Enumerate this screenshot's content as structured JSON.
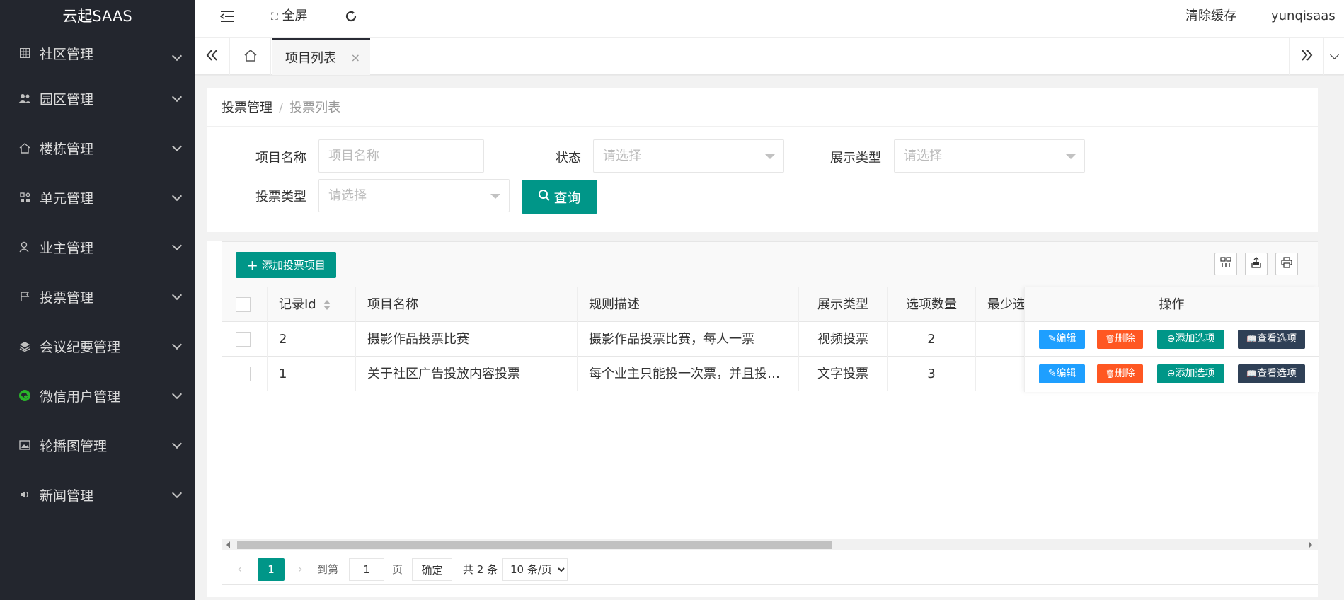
{
  "app": {
    "logo": "云起SAAS"
  },
  "sidebar": {
    "items": [
      {
        "label": "社区管理",
        "icon": "grid-icon"
      },
      {
        "label": "园区管理",
        "icon": "users-icon"
      },
      {
        "label": "楼栋管理",
        "icon": "home-icon"
      },
      {
        "label": "单元管理",
        "icon": "apps-icon"
      },
      {
        "label": "业主管理",
        "icon": "user-icon"
      },
      {
        "label": "投票管理",
        "icon": "flag-icon"
      },
      {
        "label": "会议纪要管理",
        "icon": "layers-icon"
      },
      {
        "label": "微信用户管理",
        "icon": "wechat-icon"
      },
      {
        "label": "轮播图管理",
        "icon": "image-icon"
      },
      {
        "label": "新闻管理",
        "icon": "speaker-icon"
      }
    ]
  },
  "header": {
    "fullscreen_label": "全屏",
    "clear_cache_label": "清除缓存",
    "username": "yunqisaas"
  },
  "tabs": {
    "active_label": "项目列表",
    "close_glyph": "×"
  },
  "breadcrumb": {
    "parent": "投票管理",
    "separator": "/",
    "current": "投票列表"
  },
  "filters": {
    "project_name_label": "项目名称",
    "project_name_placeholder": "项目名称",
    "status_label": "状态",
    "status_placeholder": "请选择",
    "display_type_label": "展示类型",
    "display_type_placeholder": "请选择",
    "vote_type_label": "投票类型",
    "vote_type_placeholder": "请选择",
    "query_label": "查询"
  },
  "toolbar": {
    "add_label": "添加投票项目"
  },
  "table": {
    "headers": {
      "record_id": "记录Id",
      "project_name": "项目名称",
      "rule_desc": "规则描述",
      "display_type": "展示类型",
      "option_count": "选项数量",
      "min": "最少选",
      "ops": "操作"
    },
    "rows": [
      {
        "record_id": "2",
        "project_name": "摄影作品投票比赛",
        "rule_desc": "摄影作品投票比赛，每人一票",
        "display_type": "视频投票",
        "option_count": "2"
      },
      {
        "record_id": "1",
        "project_name": "关于社区广告投放内容投票",
        "rule_desc": "每个业主只能投一次票，并且投…",
        "display_type": "文字投票",
        "option_count": "3"
      }
    ],
    "row_actions": {
      "edit": "编辑",
      "delete": "删除",
      "add_option": "添加选项",
      "view_option": "查看选项"
    }
  },
  "pager": {
    "current_page": "1",
    "goto_label": "到第",
    "goto_value": "1",
    "page_suffix": "页",
    "confirm_label": "确定",
    "total_label": "共 2 条",
    "page_size": "10 条/页"
  },
  "colors": {
    "primary": "#009688",
    "sidebar_bg": "#23262e",
    "edit": "#1e9fff",
    "delete": "#ff5722",
    "view": "#2f4056"
  }
}
